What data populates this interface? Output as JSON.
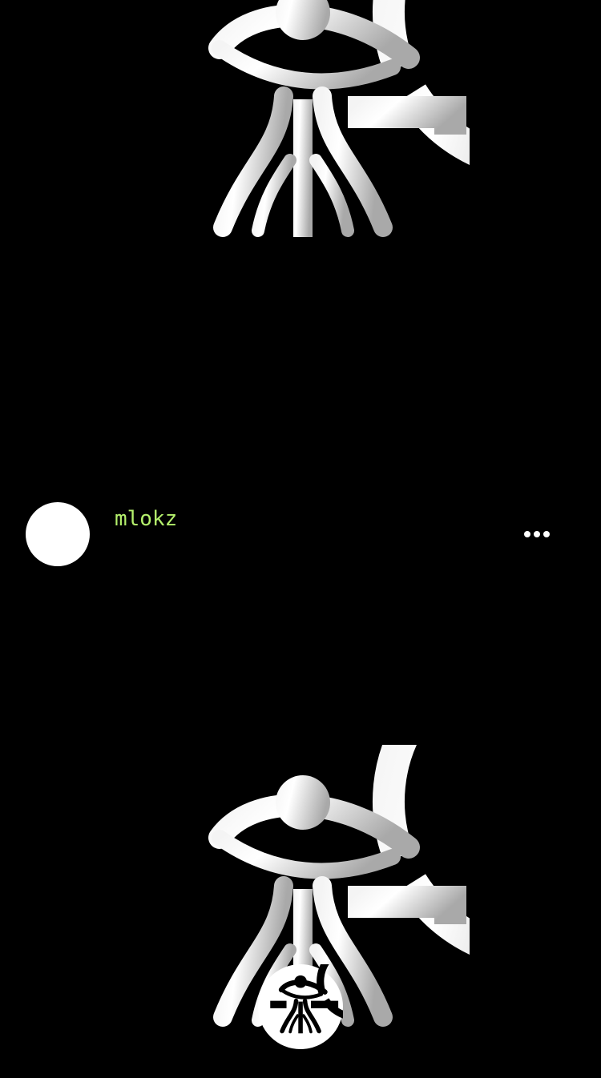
{
  "colors": {
    "background": "#000000",
    "username": "#b4f06c",
    "avatar": "#ffffff",
    "logo_light": "#ffffff",
    "logo_dark": "#a8a8a8"
  },
  "icons": {
    "top_logo": "vitruvian-circle-logo-icon",
    "bottom_logo": "vitruvian-circle-logo-icon",
    "badge": "vitruvian-circle-badge-icon",
    "more": "more-horizontal-icon"
  },
  "user": {
    "username": "mlokz"
  }
}
